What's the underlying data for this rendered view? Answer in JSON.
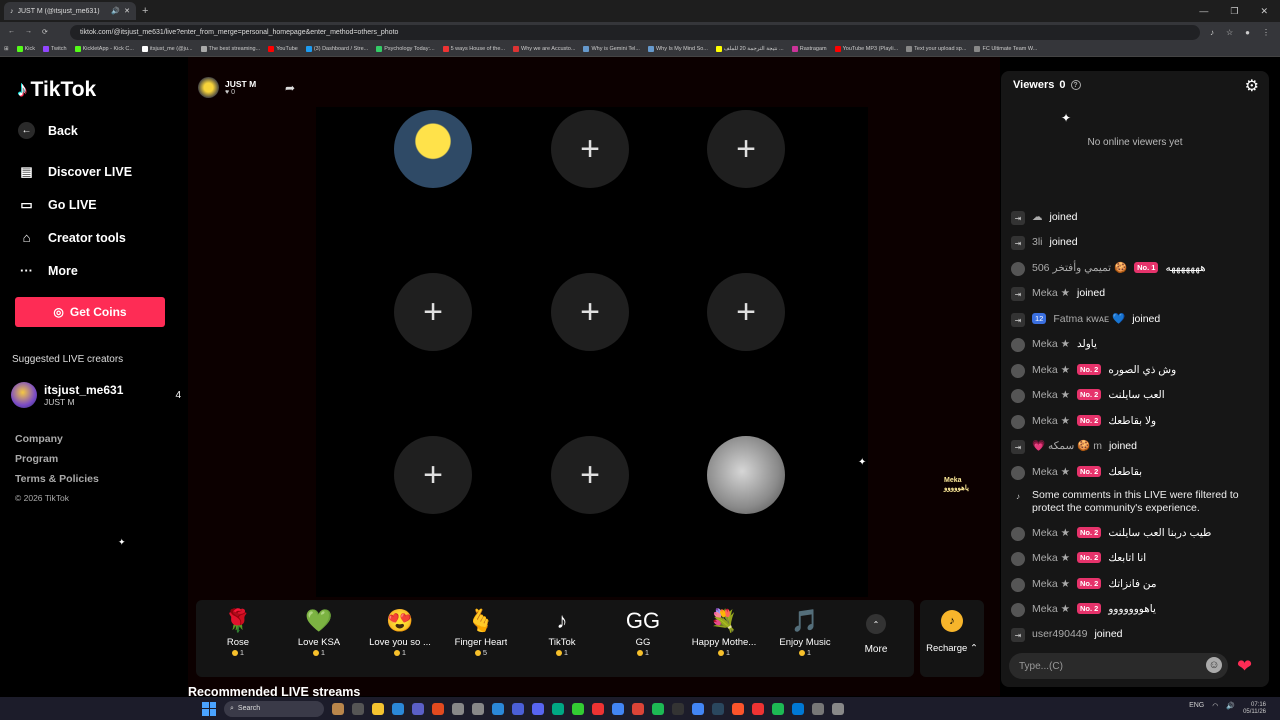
{
  "browser": {
    "tab_title": "JUST M (@itsjust_me631)",
    "url": "tiktok.com/@itsjust_me631/live?enter_from_merge=personal_homepage&enter_method=others_photo",
    "bookmarks": [
      "Kick",
      "Twitch",
      "KickletApp - Kick C...",
      "itsjust_me (@ju...",
      "The best streaming...",
      "YouTube",
      "(3) Dashboard / Stre...",
      "Psychology Today:...",
      "5 ways House of the...",
      "Why we are Accusto...",
      "Why is Gemini Tel...",
      "Why Is My Mind So...",
      "نتيجة الترجمة 20 للملف ...",
      "Rastragam",
      "YouTube MP3 (Playli...",
      "Text your upload sp...",
      "FC Ultimate Team W..."
    ]
  },
  "sidebar": {
    "logo": "TikTok",
    "back": "Back",
    "nav": [
      "Discover LIVE",
      "Go LIVE",
      "Creator tools",
      "More"
    ],
    "get_coins": "Get Coins",
    "suggested_title": "Suggested LIVE creators",
    "creator": {
      "name": "itsjust_me631",
      "sub": "JUST M",
      "count": "4"
    },
    "footer": [
      "Company",
      "Program",
      "Terms & Policies"
    ],
    "copyright": "© 2026 TikTok"
  },
  "stage": {
    "host_name": "JUST M",
    "host_likes": "0",
    "float_name": "Meka",
    "float_text": "ياهووووو",
    "recommended": "Recommended LIVE streams"
  },
  "gifts": [
    {
      "name": "Rose",
      "price": "1",
      "icon": "rose-icon",
      "emoji": "🌹"
    },
    {
      "name": "Love KSA",
      "price": "1",
      "icon": "love-ksa-icon",
      "emoji": "💚"
    },
    {
      "name": "Love you so ...",
      "price": "1",
      "icon": "love-you-icon",
      "emoji": "😍"
    },
    {
      "name": "Finger Heart",
      "price": "5",
      "icon": "finger-heart-icon",
      "emoji": "🫰"
    },
    {
      "name": "TikTok",
      "price": "1",
      "icon": "tiktok-gift-icon",
      "emoji": "♪"
    },
    {
      "name": "GG",
      "price": "1",
      "icon": "gg-icon",
      "emoji": "GG"
    },
    {
      "name": "Happy Mothe...",
      "price": "1",
      "icon": "flowers-icon",
      "emoji": "💐"
    },
    {
      "name": "Enjoy Music",
      "price": "1",
      "icon": "music-note-icon",
      "emoji": "🎵"
    }
  ],
  "gift_more": "More",
  "recharge": "Recharge",
  "chat": {
    "viewers_label": "Viewers",
    "viewers_count": "0",
    "no_viewers": "No online viewers yet",
    "input_placeholder": "Type...(C)",
    "messages": [
      {
        "type": "join",
        "name": "☁",
        "text": "joined"
      },
      {
        "type": "join",
        "name": "3li",
        "text": "joined"
      },
      {
        "type": "chat",
        "name": "506 تميمي وأفتخر 🍪",
        "badge": "No. 1",
        "text": "هههههههه"
      },
      {
        "type": "join",
        "name": "Meka ★",
        "text": "joined"
      },
      {
        "type": "join",
        "level": "12",
        "name": "Fatma ᴋᴡᴀᴇ 💙",
        "text": "joined"
      },
      {
        "type": "chat",
        "name": "Meka ★",
        "text": "ياولد"
      },
      {
        "type": "chat",
        "name": "Meka ★",
        "badge": "No. 2",
        "text": "وش ذي الصوره"
      },
      {
        "type": "chat",
        "name": "Meka ★",
        "badge": "No. 2",
        "text": "العب سايلنت"
      },
      {
        "type": "chat",
        "name": "Meka ★",
        "badge": "No. 2",
        "text": "ولا بقاطعك"
      },
      {
        "type": "join",
        "name": "💗 سمكه 🍪 m",
        "text": "joined"
      },
      {
        "type": "chat",
        "name": "Meka ★",
        "badge": "No. 2",
        "text": "بقاطعك"
      },
      {
        "type": "system",
        "text": "Some comments in this LIVE were filtered to protect the community's experience."
      },
      {
        "type": "chat",
        "name": "Meka ★",
        "badge": "No. 2",
        "text": "طيب دربنا العب سايلنت"
      },
      {
        "type": "chat",
        "name": "Meka ★",
        "badge": "No. 2",
        "text": "انا اتابعك"
      },
      {
        "type": "chat",
        "name": "Meka ★",
        "badge": "No. 2",
        "text": "من فانزاتك"
      },
      {
        "type": "chat",
        "name": "Meka ★",
        "badge": "No. 2",
        "text": "ياهووووووو"
      },
      {
        "type": "join",
        "name": "user490449",
        "text": "joined"
      }
    ]
  },
  "taskbar": {
    "search": "Search",
    "lang": "ENG",
    "time": "07:16",
    "date": "05/11/26"
  }
}
